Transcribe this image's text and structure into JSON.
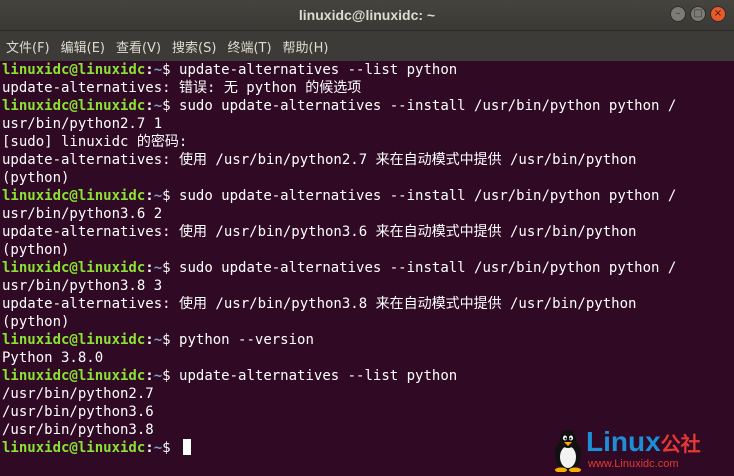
{
  "window": {
    "title": "linuxidc@linuxidc: ~",
    "close_glyph": "×",
    "minimize_glyph": "–",
    "maximize_glyph": "□"
  },
  "menu": {
    "items": [
      {
        "label": "文件(F)"
      },
      {
        "label": "编辑(E)"
      },
      {
        "label": "查看(V)"
      },
      {
        "label": "搜索(S)"
      },
      {
        "label": "终端(T)"
      },
      {
        "label": "帮助(H)"
      }
    ]
  },
  "prompt": {
    "user": "linuxidc@linuxidc",
    "sep": ":",
    "path": "~",
    "dollar": "$ "
  },
  "terminal": {
    "lines": [
      {
        "prompt": true,
        "text": "update-alternatives --list python"
      },
      {
        "prompt": false,
        "text": "update-alternatives: 错误: 无 python 的候选项"
      },
      {
        "prompt": true,
        "text": "sudo update-alternatives --install /usr/bin/python python /"
      },
      {
        "prompt": false,
        "text": "usr/bin/python2.7 1"
      },
      {
        "prompt": false,
        "text": "[sudo] linuxidc 的密码:"
      },
      {
        "prompt": false,
        "text": "update-alternatives: 使用 /usr/bin/python2.7 来在自动模式中提供 /usr/bin/python"
      },
      {
        "prompt": false,
        "text": "(python)"
      },
      {
        "prompt": true,
        "text": "sudo update-alternatives --install /usr/bin/python python /"
      },
      {
        "prompt": false,
        "text": "usr/bin/python3.6 2"
      },
      {
        "prompt": false,
        "text": "update-alternatives: 使用 /usr/bin/python3.6 来在自动模式中提供 /usr/bin/python"
      },
      {
        "prompt": false,
        "text": "(python)"
      },
      {
        "prompt": true,
        "text": "sudo update-alternatives --install /usr/bin/python python /"
      },
      {
        "prompt": false,
        "text": "usr/bin/python3.8 3"
      },
      {
        "prompt": false,
        "text": "update-alternatives: 使用 /usr/bin/python3.8 来在自动模式中提供 /usr/bin/python"
      },
      {
        "prompt": false,
        "text": "(python)"
      },
      {
        "prompt": true,
        "text": "python --version"
      },
      {
        "prompt": false,
        "text": "Python 3.8.0"
      },
      {
        "prompt": true,
        "text": "update-alternatives --list python"
      },
      {
        "prompt": false,
        "text": "/usr/bin/python2.7"
      },
      {
        "prompt": false,
        "text": "/usr/bin/python3.6"
      },
      {
        "prompt": false,
        "text": "/usr/bin/python3.8"
      },
      {
        "prompt": true,
        "text": ""
      }
    ]
  },
  "watermark": {
    "brand": "Linux",
    "brand_cn": "公社",
    "url": "www.Linuxidc.com"
  },
  "colors": {
    "terminal_bg": "#300a24",
    "prompt_user": "#8ae234",
    "prompt_path": "#729fcf",
    "close_button": "#e9592a"
  }
}
